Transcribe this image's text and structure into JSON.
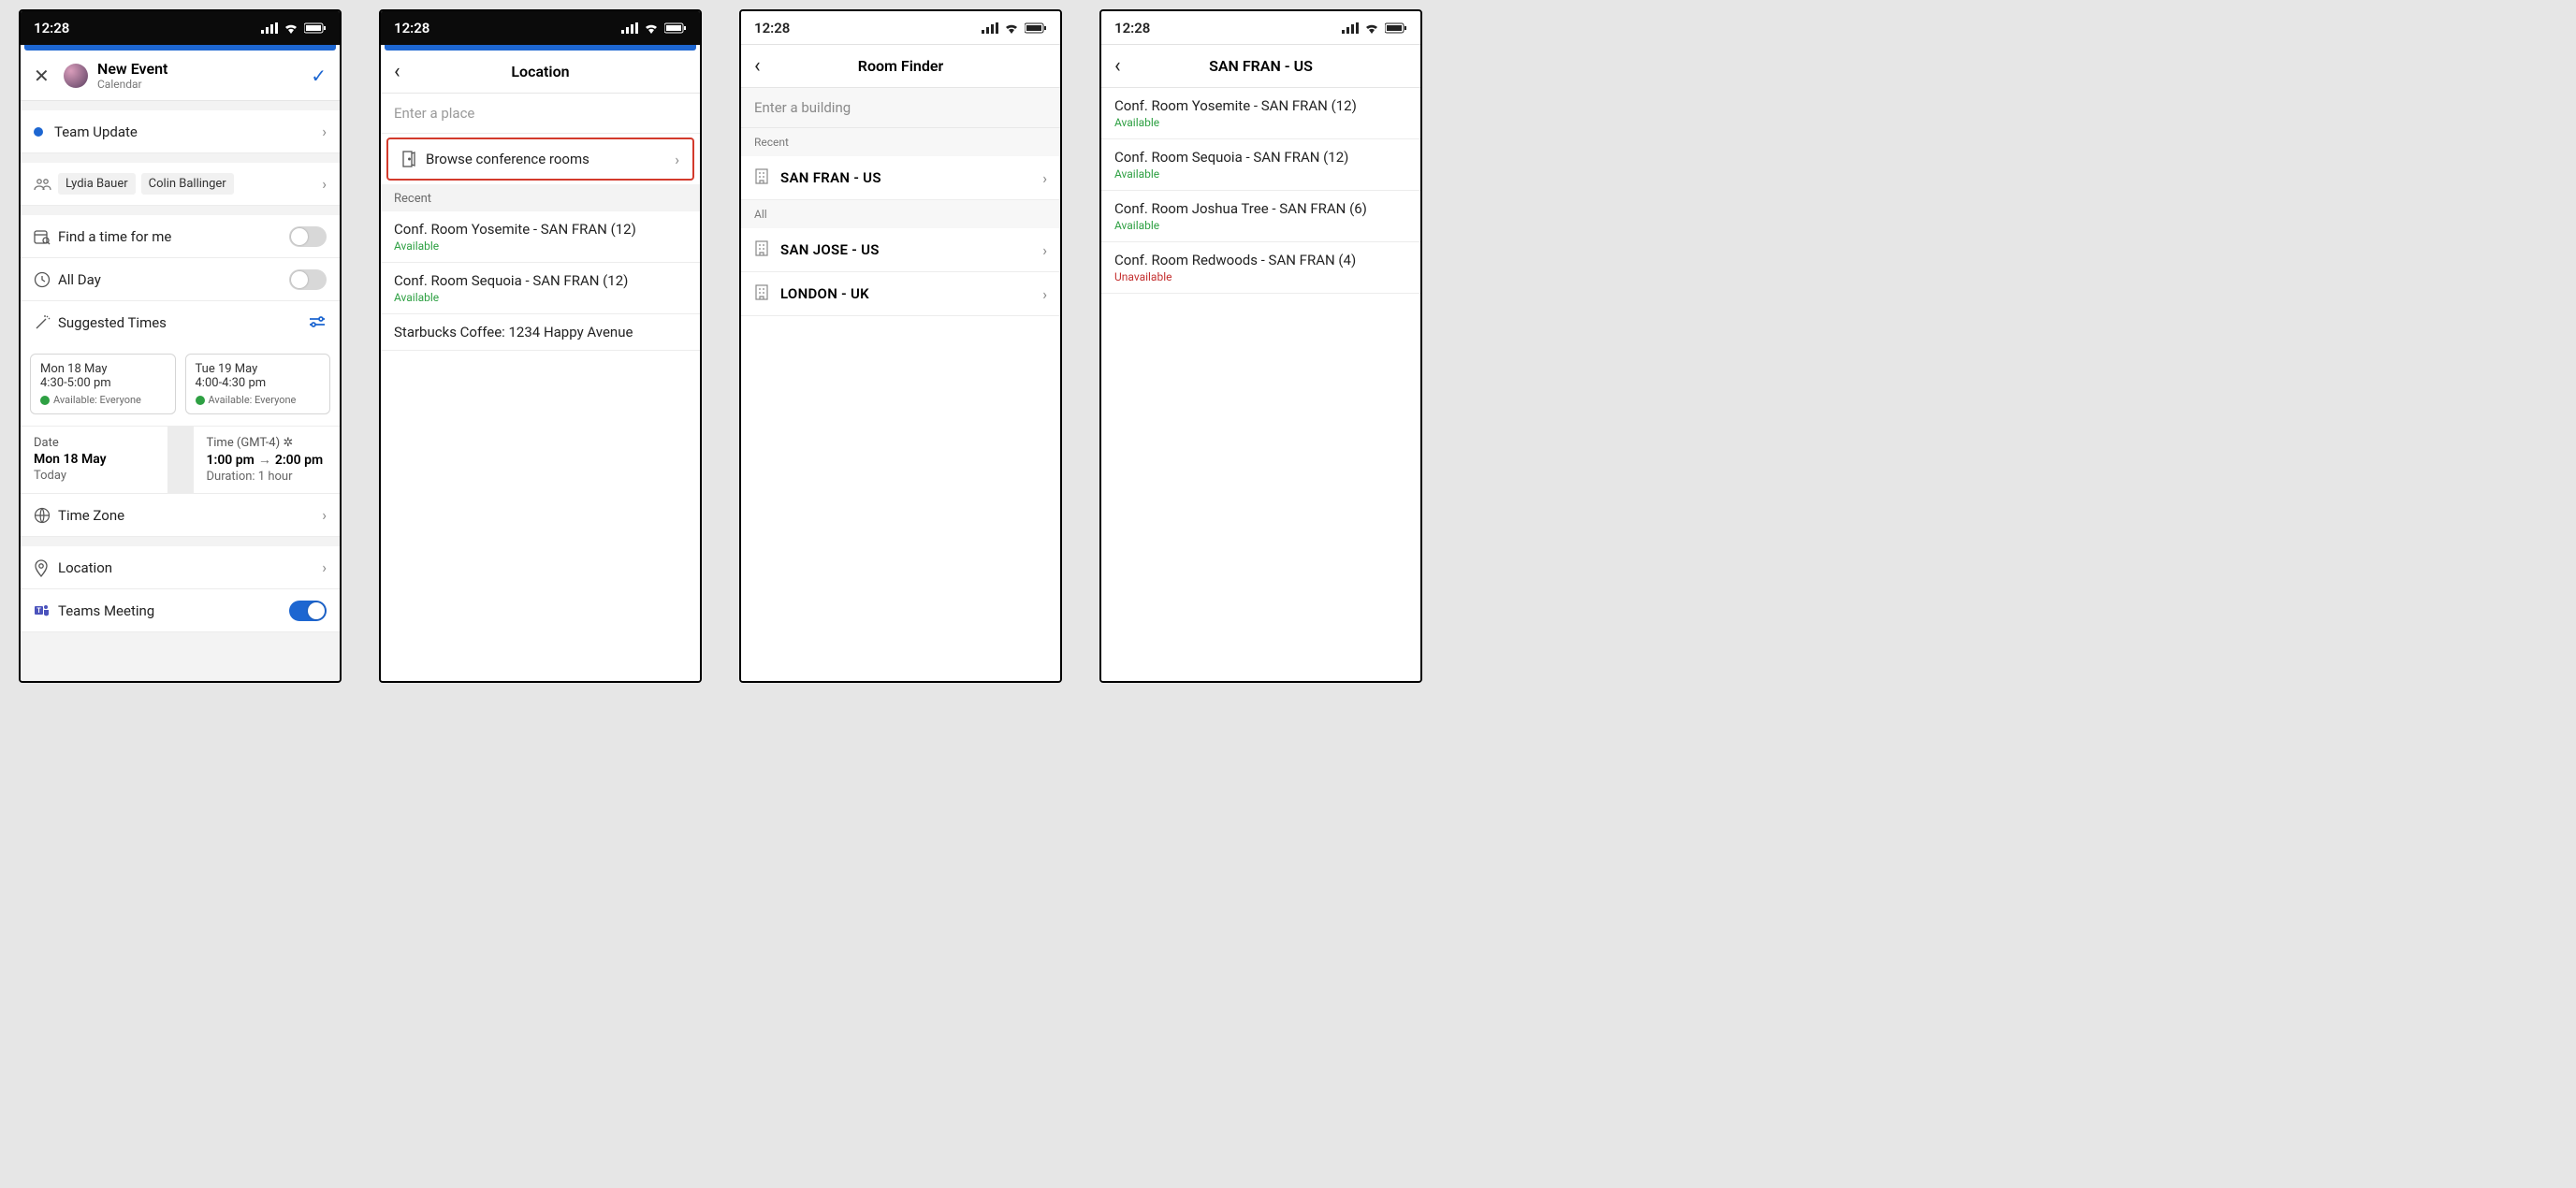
{
  "statusbar": {
    "time": "12:28"
  },
  "screen1": {
    "nav": {
      "title": "New Event",
      "subtitle": "Calendar"
    },
    "event_title": "Team Update",
    "attendees": [
      "Lydia Bauer",
      "Colin Ballinger"
    ],
    "findtime_label": "Find a time for me",
    "allday_label": "All Day",
    "suggested_label": "Suggested Times",
    "suggestions": [
      {
        "date": "Mon 18 May",
        "time": "4:30-5:00 pm",
        "avail": "Available: Everyone"
      },
      {
        "date": "Tue 19 May",
        "time": "4:00-4:30 pm",
        "avail": "Available: Everyone"
      }
    ],
    "date": {
      "label": "Date",
      "value": "Mon 18 May",
      "sub": "Today"
    },
    "time": {
      "label": "Time (GMT-4)",
      "start": "1:00 pm",
      "end": "2:00 pm",
      "duration": "Duration: 1 hour"
    },
    "timezone_label": "Time Zone",
    "location_label": "Location",
    "teams_label": "Teams Meeting"
  },
  "screen2": {
    "title": "Location",
    "search_placeholder": "Enter a place",
    "browse_label": "Browse conference rooms",
    "recent_label": "Recent",
    "recent_rooms": [
      {
        "name": "Conf. Room Yosemite - SAN FRAN (12)",
        "status": "Available",
        "status_class": "avail"
      },
      {
        "name": "Conf. Room Sequoia - SAN FRAN (12)",
        "status": "Available",
        "status_class": "avail"
      }
    ],
    "recent_places": [
      "Starbucks Coffee: 1234 Happy Avenue"
    ]
  },
  "screen3": {
    "title": "Room Finder",
    "search_placeholder": "Enter a building",
    "recent_label": "Recent",
    "all_label": "All",
    "recent_buildings": [
      "SAN FRAN - US"
    ],
    "all_buildings": [
      "SAN JOSE - US",
      "LONDON - UK"
    ]
  },
  "screen4": {
    "title": "SAN FRAN - US",
    "rooms": [
      {
        "name": "Conf. Room Yosemite - SAN FRAN (12)",
        "status": "Available",
        "status_class": "avail"
      },
      {
        "name": "Conf. Room Sequoia - SAN FRAN (12)",
        "status": "Available",
        "status_class": "avail"
      },
      {
        "name": "Conf. Room Joshua Tree - SAN FRAN (6)",
        "status": "Available",
        "status_class": "avail"
      },
      {
        "name": "Conf. Room Redwoods - SAN FRAN (4)",
        "status": "Unavailable",
        "status_class": "unavail"
      }
    ]
  }
}
